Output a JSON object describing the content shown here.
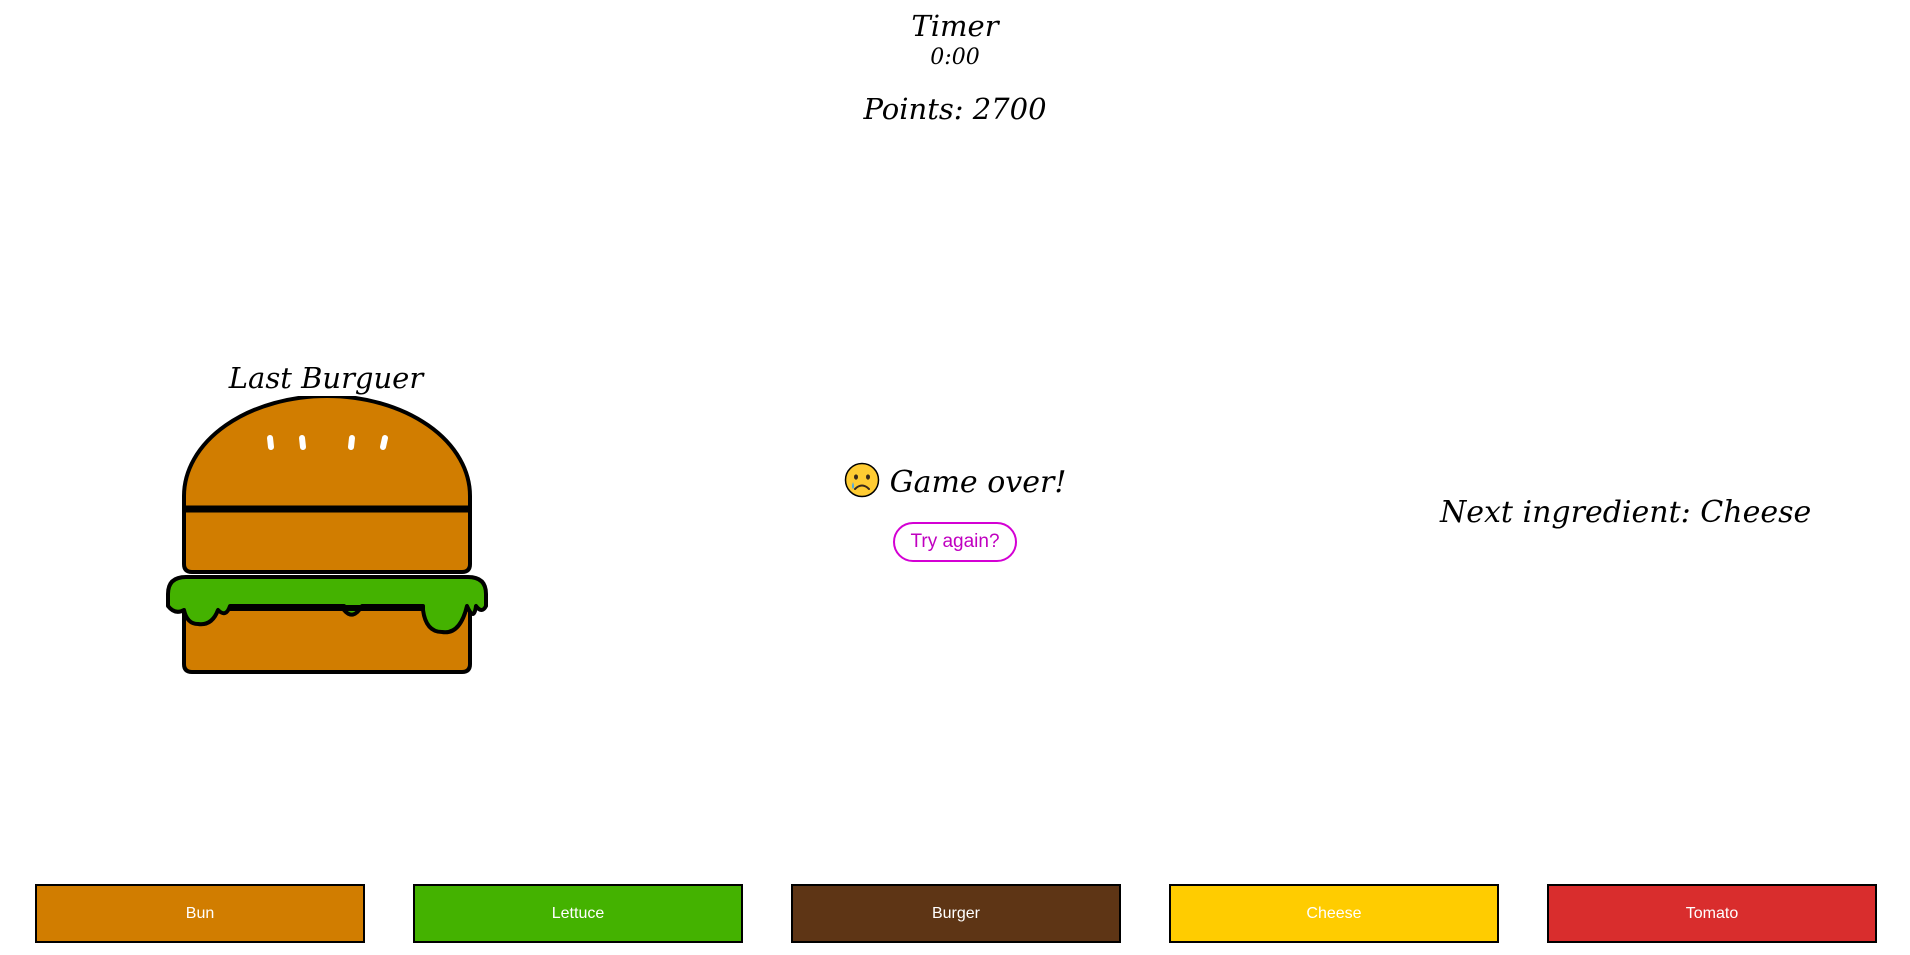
{
  "header": {
    "timer_label": "Timer",
    "timer_value": "0:00",
    "points_text": "Points: 2700"
  },
  "last_burger": {
    "label": "Last Burguer",
    "layers_top_to_bottom": [
      "Bun",
      "Lettuce",
      "Bun"
    ]
  },
  "status": {
    "icon": "sad-face-icon",
    "message": "Game over!",
    "retry_label": "Try again?"
  },
  "next_ingredient": {
    "text": "Next ingredient: Cheese"
  },
  "ingredient_buttons": [
    {
      "label": "Bun",
      "color": "#D17D00"
    },
    {
      "label": "Lettuce",
      "color": "#44B200"
    },
    {
      "label": "Burger",
      "color": "#5E3515"
    },
    {
      "label": "Cheese",
      "color": "#FFCC00"
    },
    {
      "label": "Tomato",
      "color": "#D92D2D"
    }
  ],
  "colors": {
    "bun": "#D17D00",
    "lettuce": "#44B200",
    "retry_accent": "#D400D4"
  }
}
